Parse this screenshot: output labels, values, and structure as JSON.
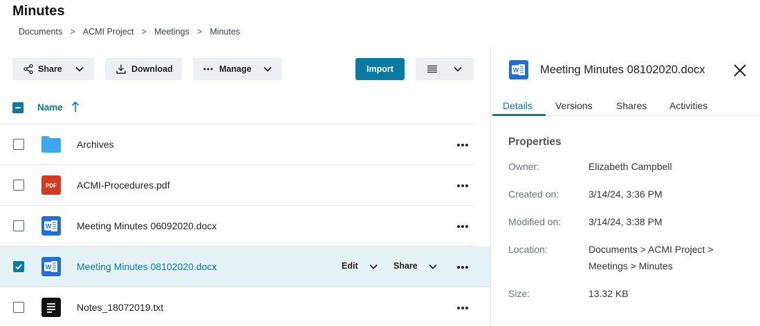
{
  "page": {
    "title": "Minutes",
    "breadcrumb": [
      "Documents",
      "ACMI Project",
      "Meetings",
      "Minutes"
    ]
  },
  "toolbar": {
    "share_label": "Share",
    "download_label": "Download",
    "manage_label": "Manage",
    "import_label": "Import"
  },
  "list": {
    "column_name": "Name",
    "sort": "ascending",
    "rows": [
      {
        "name": "Archives",
        "type": "folder",
        "checked": false
      },
      {
        "name": "ACMI-Procedures.pdf",
        "type": "pdf",
        "icon_text": "PDF",
        "checked": false
      },
      {
        "name": "Meeting Minutes 06092020.docx",
        "type": "docx",
        "checked": false
      },
      {
        "name": "Meeting Minutes 08102020.docx",
        "type": "docx",
        "checked": true,
        "edit_label": "Edit",
        "share_label": "Share"
      },
      {
        "name": "Notes_18072019.txt",
        "type": "txt",
        "checked": false
      }
    ]
  },
  "panel": {
    "title": "Meeting Minutes 08102020.docx",
    "tabs": [
      "Details",
      "Versions",
      "Shares",
      "Activities"
    ],
    "active_tab": "Details",
    "properties_title": "Properties",
    "properties": {
      "owner_label": "Owner:",
      "owner": "Elizabeth Campbell",
      "created_label": "Created on:",
      "created": "3/14/24, 3:36 PM",
      "modified_label": "Modified on:",
      "modified": "3/14/24, 3:38 PM",
      "location_label": "Location:",
      "location_line1": "Documents > ACMI Project >",
      "location_line2": "Meetings > Minutes",
      "size_label": "Size:",
      "size": "13.32 KB"
    }
  },
  "colors": {
    "accent": "#0a7aa0",
    "selected_row": "#e4f1f5",
    "folder": "#3ba8f0",
    "pdf": "#d33a1f",
    "word": "#1f6fd6",
    "txt": "#111111"
  }
}
